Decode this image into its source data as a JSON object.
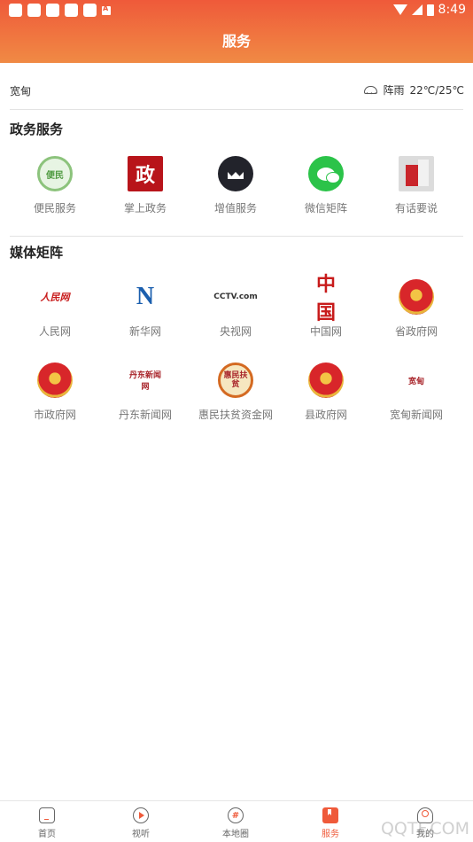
{
  "status_bar": {
    "time": "8:49"
  },
  "header": {
    "title": "服务"
  },
  "weather": {
    "location": "宽甸",
    "condition": "阵雨",
    "temperature": "22℃/25℃"
  },
  "sections": {
    "gov": {
      "title": "政务服务",
      "items": [
        {
          "label": "便民服务",
          "icon_text": "便民",
          "icon": "bianmin-icon"
        },
        {
          "label": "掌上政务",
          "icon_text": "政",
          "icon": "zheng-icon"
        },
        {
          "label": "增值服务",
          "icon": "crown-icon"
        },
        {
          "label": "微信矩阵",
          "icon": "wechat-icon"
        },
        {
          "label": "有话要说",
          "icon": "speak-icon"
        }
      ]
    },
    "media": {
      "title": "媒体矩阵",
      "items": [
        {
          "label": "人民网",
          "icon_text": "人民网",
          "icon": "people-daily-logo-icon"
        },
        {
          "label": "新华网",
          "icon_text": "N",
          "icon": "xinhua-logo-icon"
        },
        {
          "label": "央视网",
          "icon_text": "CCTV.com",
          "icon": "cctv-logo-icon"
        },
        {
          "label": "中国网",
          "icon_text": "中国",
          "icon": "china-net-logo-icon"
        },
        {
          "label": "省政府网",
          "icon": "national-emblem-icon"
        },
        {
          "label": "市政府网",
          "icon": "national-emblem-icon"
        },
        {
          "label": "丹东新闻网",
          "icon_text": "丹东新闻网",
          "icon": "dandong-news-logo-icon"
        },
        {
          "label": "惠民扶贫资金网",
          "icon_text": "惠民扶贫",
          "icon": "huimin-seal-icon"
        },
        {
          "label": "县政府网",
          "icon": "national-emblem-icon"
        },
        {
          "label": "宽甸新闻网",
          "icon_text": "宽甸",
          "icon": "kuandian-news-logo-icon"
        }
      ]
    }
  },
  "tabbar": {
    "items": [
      {
        "label": "首页",
        "icon": "home-icon"
      },
      {
        "label": "视听",
        "icon": "play-icon"
      },
      {
        "label": "本地圈",
        "icon": "hashtag-icon"
      },
      {
        "label": "服务",
        "icon": "bookmark-icon",
        "active": true
      },
      {
        "label": "我的",
        "icon": "user-icon"
      }
    ]
  },
  "watermark": "QQTF.COM",
  "colors": {
    "accent": "#ef5a3a",
    "header_gradient_end": "#f08a44"
  }
}
